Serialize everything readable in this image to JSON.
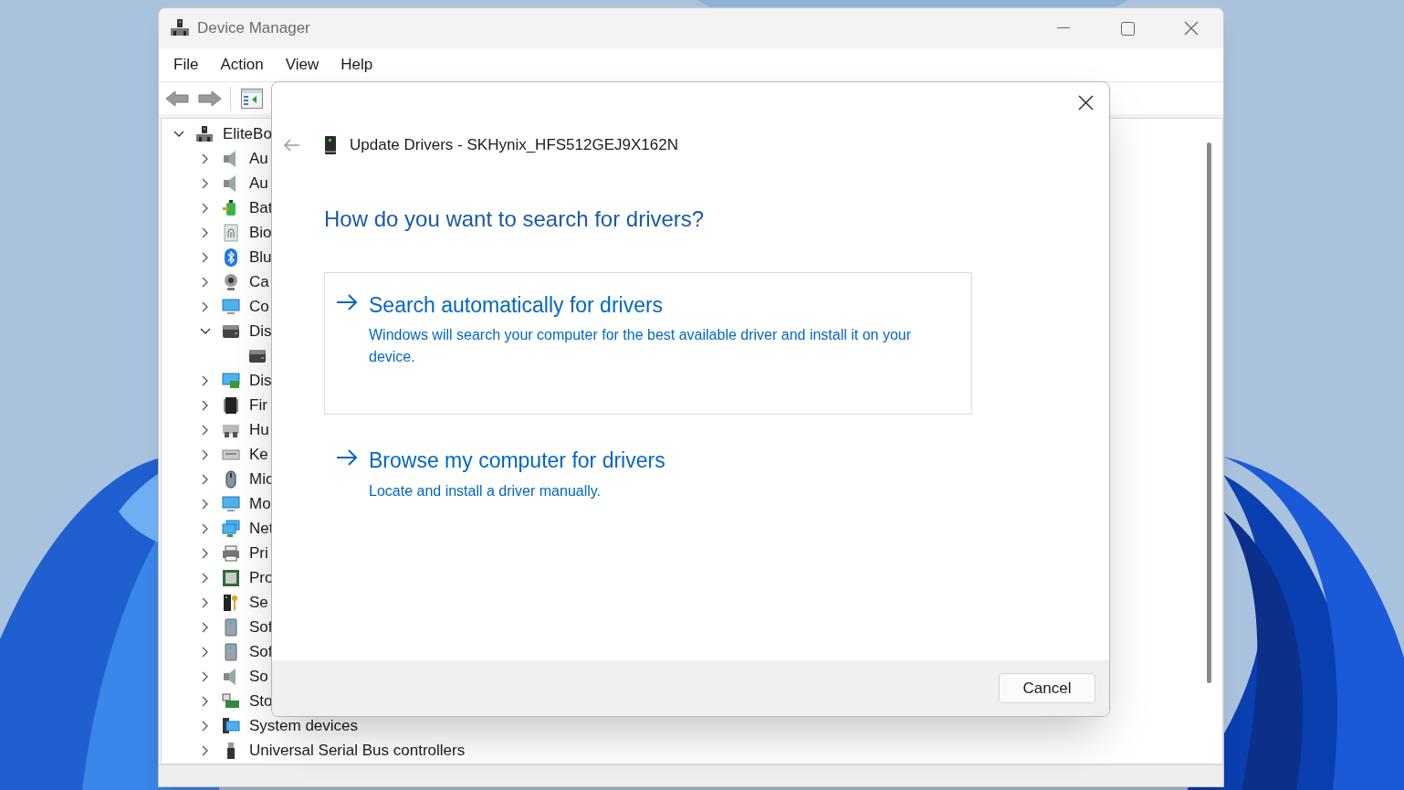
{
  "window": {
    "title": "Device Manager"
  },
  "menu": [
    "File",
    "Action",
    "View",
    "Help"
  ],
  "tree": {
    "label": "EliteBo",
    "kind": "computer",
    "expanded": true,
    "children": [
      {
        "label": "Au",
        "kind": "speaker",
        "expanded": false
      },
      {
        "label": "Au",
        "kind": "speaker",
        "expanded": false
      },
      {
        "label": "Bat",
        "kind": "battery",
        "expanded": false
      },
      {
        "label": "Bio",
        "kind": "fingerprint",
        "expanded": false
      },
      {
        "label": "Blu",
        "kind": "bluetooth",
        "expanded": false
      },
      {
        "label": "Ca",
        "kind": "camera",
        "expanded": false
      },
      {
        "label": "Co",
        "kind": "monitor",
        "expanded": false
      },
      {
        "label": "Dis",
        "kind": "disk",
        "expanded": true,
        "children": [
          {
            "kind": "disk"
          }
        ]
      },
      {
        "label": "Dis",
        "kind": "display",
        "expanded": false
      },
      {
        "label": "Fir",
        "kind": "chip",
        "expanded": false
      },
      {
        "label": "Hu",
        "kind": "gamepad",
        "expanded": false
      },
      {
        "label": "Ke",
        "kind": "keyboard",
        "expanded": false
      },
      {
        "label": "Mic",
        "kind": "mouse",
        "expanded": false
      },
      {
        "label": "Mo",
        "kind": "monitor",
        "expanded": false
      },
      {
        "label": "Net",
        "kind": "network",
        "expanded": false
      },
      {
        "label": "Pri",
        "kind": "printer",
        "expanded": false
      },
      {
        "label": "Pro",
        "kind": "processor",
        "expanded": false
      },
      {
        "label": "Se",
        "kind": "key",
        "expanded": false
      },
      {
        "label": "Sof",
        "kind": "tower",
        "expanded": false
      },
      {
        "label": "Sof",
        "kind": "tower",
        "expanded": false
      },
      {
        "label": "So",
        "kind": "speaker",
        "expanded": false
      },
      {
        "label": "Sto",
        "kind": "storage",
        "expanded": false
      },
      {
        "label": "System devices",
        "kind": "system",
        "expanded": false
      },
      {
        "label": "Universal Serial Bus controllers",
        "kind": "usb",
        "expanded": false
      }
    ]
  },
  "dialog": {
    "title": "Update Drivers - SKHynix_HFS512GEJ9X162N",
    "heading": "How do you want to search for drivers?",
    "options": [
      {
        "title": "Search automatically for drivers",
        "description": "Windows will search your computer for the best available driver and install it on your device.",
        "highlighted": true
      },
      {
        "title": "Browse my computer for drivers",
        "description": "Locate and install a driver manually.",
        "highlighted": false
      }
    ],
    "buttons": [
      "Cancel"
    ]
  }
}
